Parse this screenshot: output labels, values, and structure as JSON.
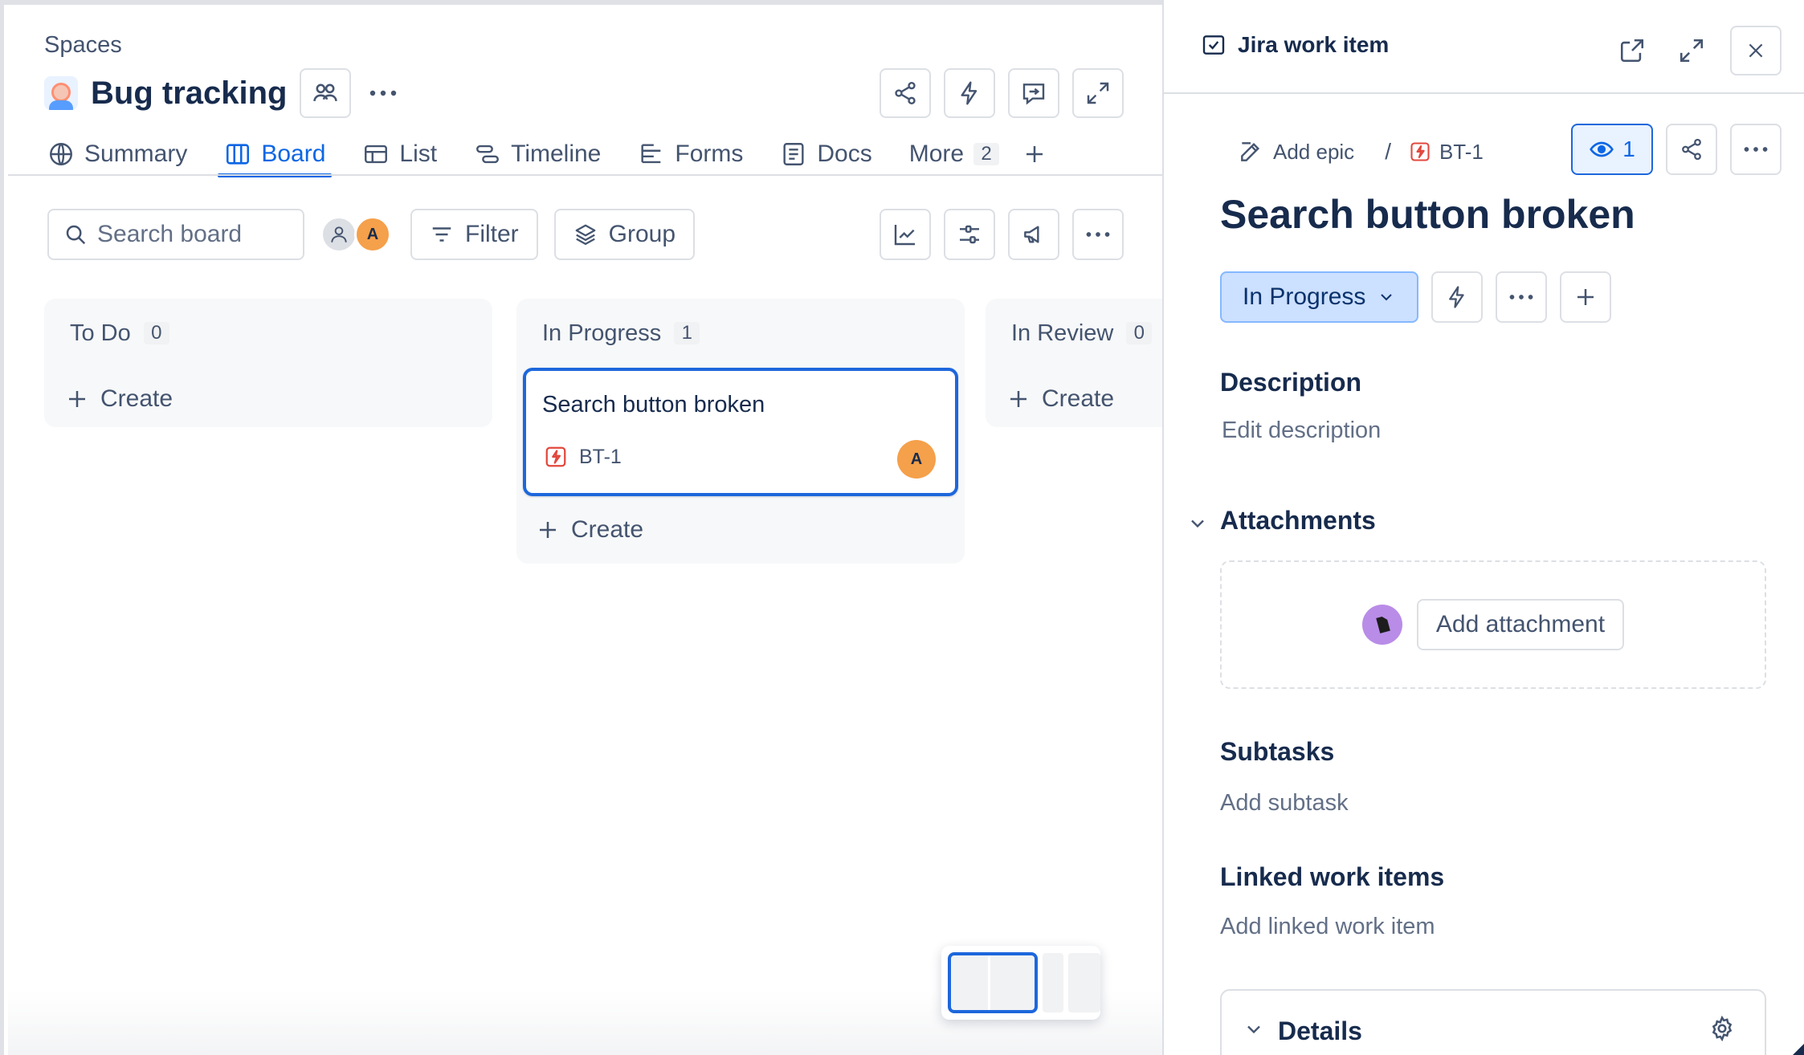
{
  "header": {
    "breadcrumb": "Spaces",
    "project_title": "Bug tracking"
  },
  "tabs": [
    {
      "label": "Summary",
      "icon": "globe-icon"
    },
    {
      "label": "Board",
      "icon": "board-icon",
      "active": true
    },
    {
      "label": "List",
      "icon": "list-icon"
    },
    {
      "label": "Timeline",
      "icon": "timeline-icon"
    },
    {
      "label": "Forms",
      "icon": "forms-icon"
    },
    {
      "label": "Docs",
      "icon": "docs-icon"
    }
  ],
  "more_tab": {
    "label": "More",
    "count": "2"
  },
  "toolbar": {
    "search_placeholder": "Search board",
    "avatar_initial": "A",
    "filter_label": "Filter",
    "group_label": "Group"
  },
  "columns": [
    {
      "title": "To Do",
      "count": "0",
      "create_label": "Create",
      "cards": []
    },
    {
      "title": "In Progress",
      "count": "1",
      "create_label": "Create",
      "cards": [
        {
          "title": "Search button broken",
          "key": "BT-1",
          "assignee_initial": "A"
        }
      ]
    },
    {
      "title": "In Review",
      "count": "0",
      "create_label": "Create",
      "cards": []
    }
  ],
  "panel": {
    "title": "Jira work item",
    "add_epic": "Add epic",
    "breadcrumb_sep": "/",
    "item_key": "BT-1",
    "watch_count": "1",
    "item_title": "Search button broken",
    "status": "In Progress",
    "description_heading": "Description",
    "description_placeholder": "Edit description",
    "attachments_heading": "Attachments",
    "add_attachment": "Add attachment",
    "subtasks_heading": "Subtasks",
    "add_subtask": "Add subtask",
    "linked_heading": "Linked work items",
    "add_linked": "Add linked work item",
    "details_heading": "Details"
  },
  "colors": {
    "accent": "#0c66e4",
    "status_bg": "#cce0ff",
    "bug_red": "#e2483d",
    "avatar_orange": "#f5a04a"
  }
}
